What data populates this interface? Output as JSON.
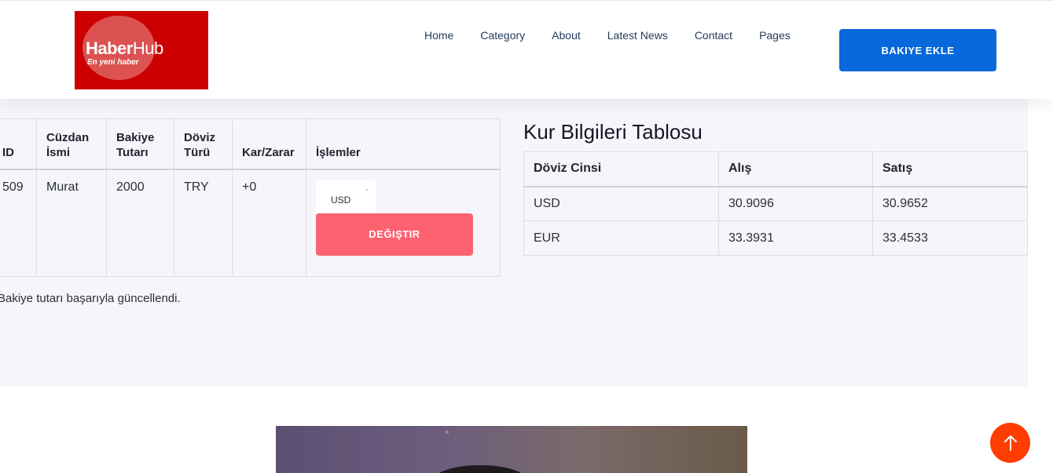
{
  "header": {
    "logo": {
      "brand_bold": "Haber",
      "brand_light": "Hub",
      "tagline": "En yeni haber"
    },
    "nav": [
      "Home",
      "Category",
      "About",
      "Latest News",
      "Contact",
      "Pages"
    ],
    "cta_label": "BAKIYE EKLE"
  },
  "wallet_table": {
    "headers": [
      "ID",
      "Cüzdan İsmi",
      "Bakiye Tutarı",
      "Döviz Türü",
      "Kar/Zarar",
      "İşlemler"
    ],
    "rows": [
      {
        "id": "509",
        "name": "Murat",
        "amount": "2000",
        "currency": "TRY",
        "profit": "+0",
        "select_value": "USD",
        "button_label": "DEĞIŞTIR"
      }
    ]
  },
  "status_message": "Bakiye tutarı başarıyla güncellendi.",
  "rates": {
    "title": "Kur Bilgileri Tablosu",
    "headers": [
      "Döviz Cinsi",
      "Alış",
      "Satış"
    ],
    "rows": [
      {
        "currency": "USD",
        "buy": "30.9096",
        "sell": "30.9652"
      },
      {
        "currency": "EUR",
        "buy": "33.3931",
        "sell": "33.4533"
      }
    ]
  },
  "colors": {
    "accent_blue": "#0768db",
    "change_button": "#fd6270",
    "scroll_top": "#ff3d00",
    "logo_bg": "#cc0000"
  },
  "icons": {
    "scroll_top": "arrow-up-icon",
    "select": "chevron-down-icon"
  }
}
